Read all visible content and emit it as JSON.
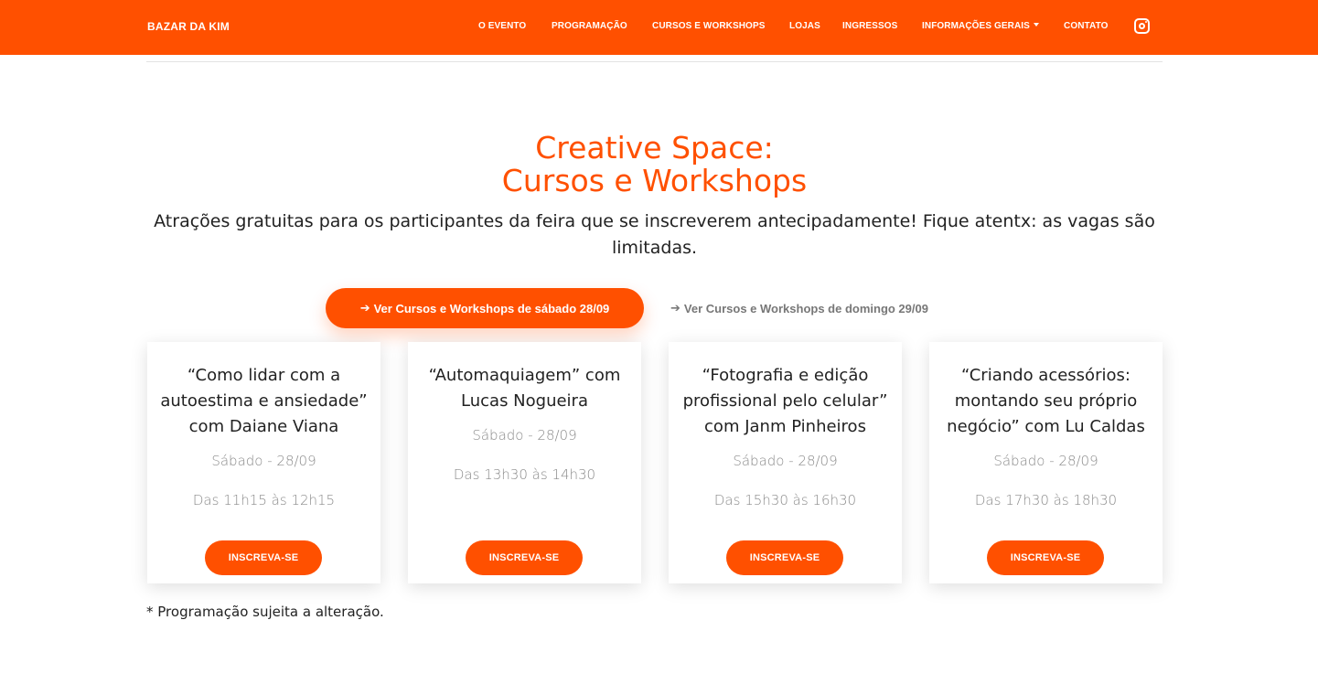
{
  "navbar": {
    "brand": "BAZAR DA KIM",
    "items": [
      {
        "label": "O EVENTO"
      },
      {
        "label": "PROGRAMAÇÃO"
      },
      {
        "label": "CURSOS E WORKSHOPS"
      },
      {
        "label": "LOJAS"
      },
      {
        "label": "INGRESSOS"
      },
      {
        "label": "INFORMAÇÕES GERAIS"
      },
      {
        "label": "CONTATO"
      }
    ],
    "social_icon": "instagram-icon"
  },
  "hero": {
    "title_line1": "Creative Space:",
    "title_line2": "Cursos e Workshops",
    "subtitle": "Atrações gratuitas para os participantes da feira que se inscreverem antecipadamente! Fique atentx: as vagas são limitadas."
  },
  "tabs": {
    "active_label": "Ver Cursos e Workshops de sábado 28/09",
    "inactive_label": "Ver Cursos e Workshops de domingo 29/09",
    "arrow_icon": "arrow-right-icon"
  },
  "cards": [
    {
      "title": "“Como lidar com a autoestima e ansiedade” com Daiane Viana",
      "date": "Sábado - 28/09",
      "time": "Das 11h15 às 12h15",
      "button": "INSCREVA-SE"
    },
    {
      "title": "“Automaquiagem” com Lucas Nogueira",
      "date": "Sábado - 28/09",
      "time": "Das 13h30 às 14h30",
      "button": "INSCREVA-SE"
    },
    {
      "title": "“Fotografia e edição profissional pelo celular” com Janm Pinheiros",
      "date": "Sábado - 28/09",
      "time": "Das 15h30 às 16h30",
      "button": "INSCREVA-SE"
    },
    {
      "title": "“Criando acessórios: montando seu próprio negócio” com Lu Caldas",
      "date": "Sábado - 28/09",
      "time": "Das 17h30 às 18h30",
      "button": "INSCREVA-SE"
    }
  ],
  "note": "* Programação sujeita a alteração.",
  "colors": {
    "accent": "#ff5000",
    "muted_text": "#8a8a8a"
  }
}
